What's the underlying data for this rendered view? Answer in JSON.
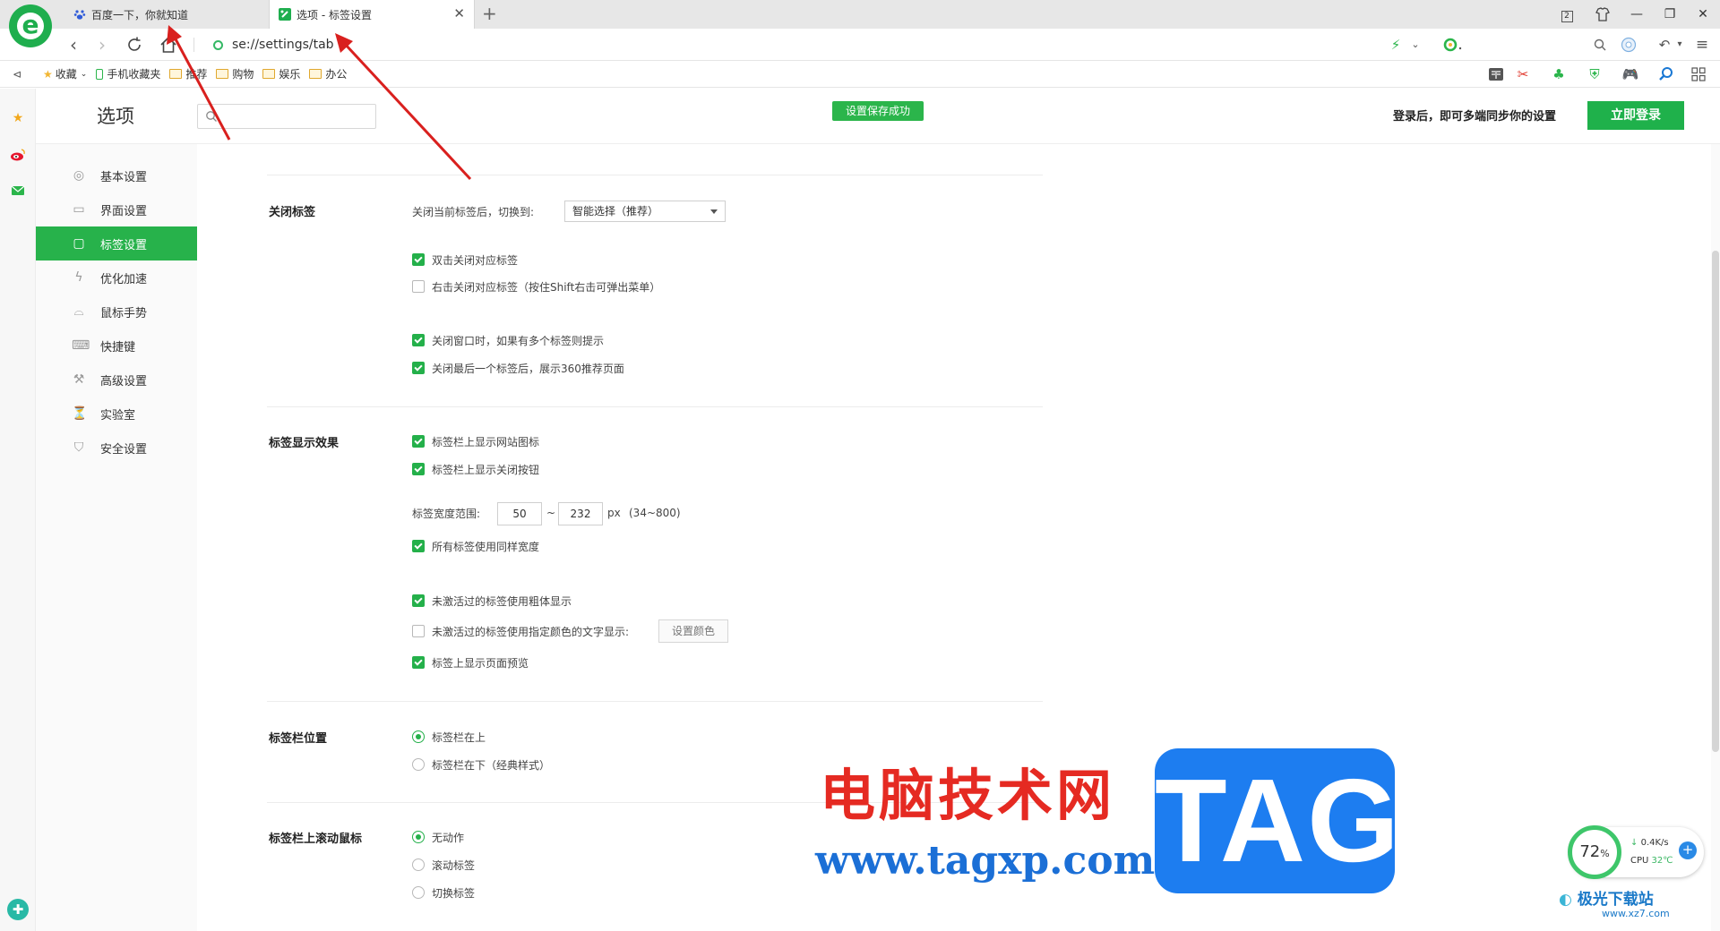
{
  "browser": {
    "tabs": [
      {
        "label": "百度一下，你就知道"
      },
      {
        "label": "选项 - 标签设置"
      }
    ],
    "url": "se://settings/tab",
    "bookmarks": [
      {
        "label": "收藏",
        "icon": "star-icon"
      },
      {
        "label": "手机收藏夹",
        "icon": "phone-icon"
      },
      {
        "label": "推荐",
        "icon": "folder-icon"
      },
      {
        "label": "购物",
        "icon": "folder-icon"
      },
      {
        "label": "娱乐",
        "icon": "folder-icon"
      },
      {
        "label": "办公",
        "icon": "folder-icon"
      }
    ],
    "tab_count_badge": "2"
  },
  "settings": {
    "title": "选项",
    "search_placeholder": "",
    "saved_toast": "设置保存成功",
    "sync_note": "登录后，即可多端同步你的设置",
    "login_label": "立即登录",
    "nav": [
      {
        "label": "基本设置",
        "icon": "gear-icon"
      },
      {
        "label": "界面设置",
        "icon": "window-icon"
      },
      {
        "label": "标签设置",
        "icon": "tab-icon",
        "active": true
      },
      {
        "label": "优化加速",
        "icon": "lightning-icon"
      },
      {
        "label": "鼠标手势",
        "icon": "mouse-icon"
      },
      {
        "label": "快捷键",
        "icon": "keyboard-icon"
      },
      {
        "label": "高级设置",
        "icon": "wrench-icon"
      },
      {
        "label": "实验室",
        "icon": "flask-icon"
      },
      {
        "label": "安全设置",
        "icon": "shield-icon"
      }
    ],
    "close_tab": {
      "heading": "关闭标签",
      "switch_label": "关闭当前标签后，切换到:",
      "switch_value": "智能选择（推荐）",
      "options": [
        {
          "label": "双击关闭对应标签",
          "checked": true
        },
        {
          "label": "右击关闭对应标签（按住Shift右击可弹出菜单）",
          "checked": false
        },
        {
          "label": "关闭窗口时，如果有多个标签则提示",
          "checked": true
        },
        {
          "label": "关闭最后一个标签后，展示360推荐页面",
          "checked": true
        }
      ]
    },
    "display": {
      "heading": "标签显示效果",
      "options_top": [
        {
          "label": "标签栏上显示网站图标",
          "checked": true
        },
        {
          "label": "标签栏上显示关闭按钮",
          "checked": true
        }
      ],
      "width_label": "标签宽度范围:",
      "width_min": "50",
      "width_sep": "~",
      "width_max": "232",
      "width_unit": "px",
      "width_hint": "(34~800)",
      "options_mid": [
        {
          "label": "所有标签使用同样宽度",
          "checked": true
        }
      ],
      "options_bottom": [
        {
          "label": "未激活过的标签使用粗体显示",
          "checked": true
        },
        {
          "label": "未激活过的标签使用指定颜色的文字显示:",
          "checked": false
        },
        {
          "label": "标签上显示页面预览",
          "checked": true
        }
      ],
      "color_button": "设置颜色"
    },
    "position": {
      "heading": "标签栏位置",
      "options": [
        {
          "label": "标签栏在上",
          "selected": true
        },
        {
          "label": "标签栏在下（经典样式）",
          "selected": false
        }
      ]
    },
    "scroll": {
      "heading": "标签栏上滚动鼠标",
      "options": [
        {
          "label": "无动作",
          "selected": true
        },
        {
          "label": "滚动标签",
          "selected": false
        },
        {
          "label": "切换标签",
          "selected": false
        }
      ]
    }
  },
  "perf_widget": {
    "percent": "72",
    "percent_unit": "%",
    "net": "0.4K/s",
    "cpu_label": "CPU",
    "cpu_temp": "32℃"
  },
  "watermark": {
    "cn": "电脑技术网",
    "url": "www.tagxp.com",
    "tag": "TAG",
    "site": "极光下载站",
    "site_url": "www.xz7.com"
  },
  "colors": {
    "accent": "#27b24b",
    "annotation_arrow": "#d9201e"
  }
}
